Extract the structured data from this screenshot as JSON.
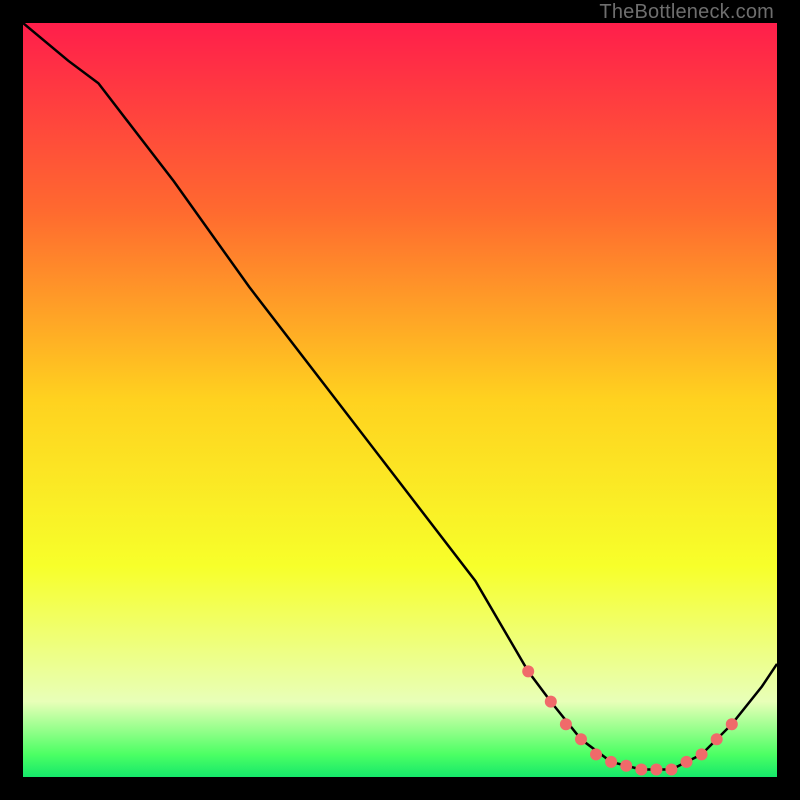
{
  "watermark": "TheBottleneck.com",
  "chart_data": {
    "type": "line",
    "title": "",
    "xlabel": "",
    "ylabel": "",
    "xlim": [
      0,
      100
    ],
    "ylim": [
      0,
      100
    ],
    "gradient_stops": [
      {
        "offset": 0,
        "color": "#ff1e4b"
      },
      {
        "offset": 0.25,
        "color": "#ff6a2f"
      },
      {
        "offset": 0.5,
        "color": "#ffd21f"
      },
      {
        "offset": 0.72,
        "color": "#f7ff2a"
      },
      {
        "offset": 0.9,
        "color": "#e8ffb8"
      },
      {
        "offset": 0.97,
        "color": "#4cff64"
      },
      {
        "offset": 1.0,
        "color": "#15e86a"
      }
    ],
    "series": [
      {
        "name": "curve",
        "x": [
          0,
          6,
          10,
          20,
          30,
          40,
          50,
          60,
          67,
          70,
          74,
          78,
          82,
          86,
          90,
          94,
          98,
          100
        ],
        "y": [
          100,
          95,
          92,
          79,
          65,
          52,
          39,
          26,
          14,
          10,
          5,
          2,
          1,
          1,
          3,
          7,
          12,
          15
        ]
      }
    ],
    "markers": {
      "name": "highlight-points",
      "x": [
        67,
        70,
        72,
        74,
        76,
        78,
        80,
        82,
        84,
        86,
        88,
        90,
        92,
        94
      ],
      "y": [
        14,
        10,
        7,
        5,
        3,
        2,
        1.5,
        1,
        1,
        1,
        2,
        3,
        5,
        7
      ],
      "color": "#f06a6a",
      "radius": 6
    }
  }
}
